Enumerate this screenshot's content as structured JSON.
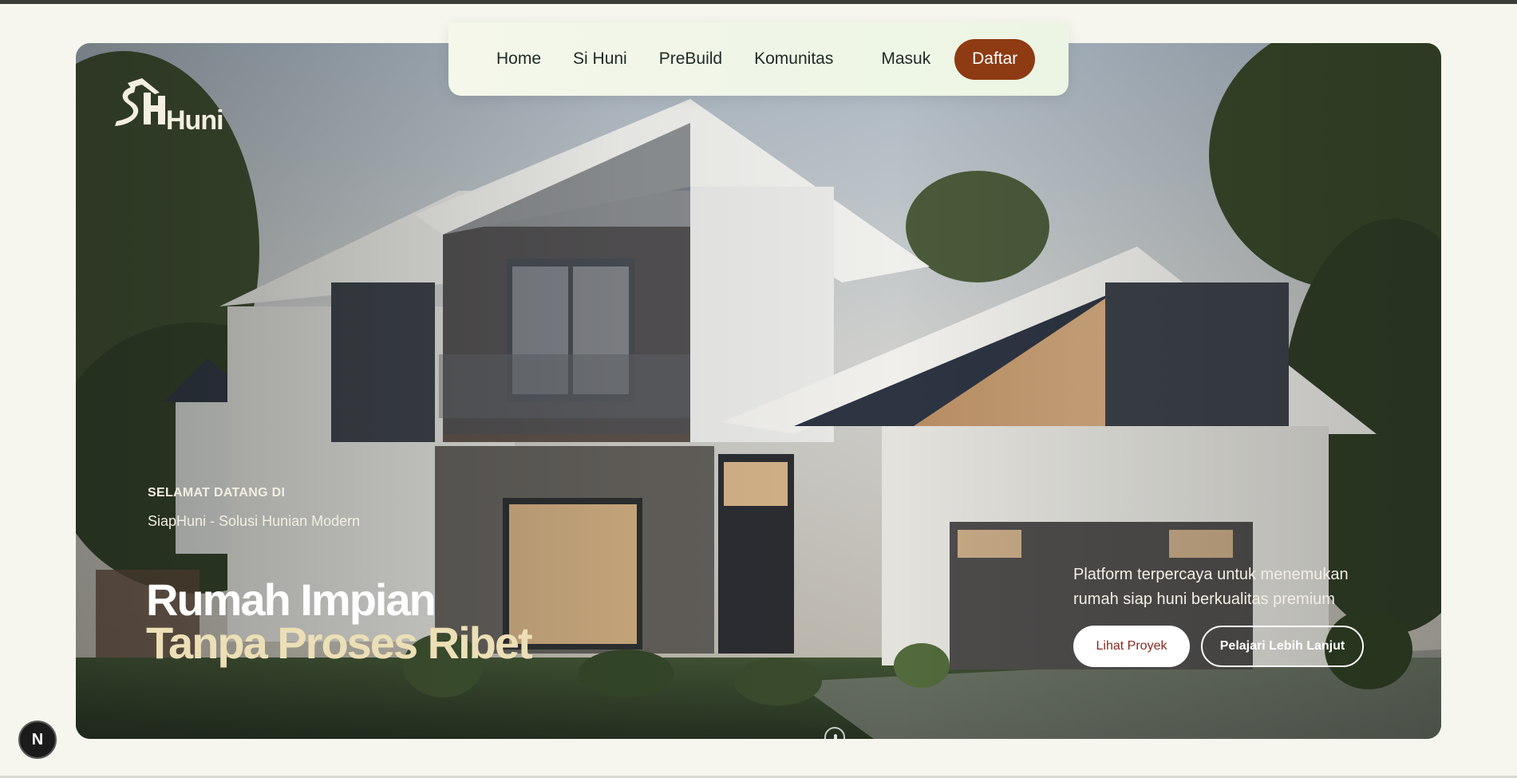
{
  "nav": {
    "items": [
      {
        "label": "Home"
      },
      {
        "label": "Si Huni"
      },
      {
        "label": "PreBuild"
      },
      {
        "label": "Komunitas"
      },
      {
        "label": "Masuk"
      }
    ],
    "cta_label": "Daftar"
  },
  "brand": {
    "logo_text": "Huni"
  },
  "hero": {
    "welcome": "SELAMAT DATANG DI",
    "subtitle": "SiapHuni - Solusi Hunian Modern",
    "headline_line1": "Rumah Impian",
    "headline_line2": "Tanpa Proses Ribet",
    "tagline": "Platform terpercaya untuk menemukan rumah siap huni berkualitas premium",
    "primary_button": "Lihat Proyek",
    "secondary_button": "Pelajari Lebih Lanjut"
  },
  "badge": {
    "label": "N"
  },
  "colors": {
    "accent": "#8e3a12",
    "page_bg": "#f6f6ee",
    "headline_accent": "#ecdfb6"
  }
}
